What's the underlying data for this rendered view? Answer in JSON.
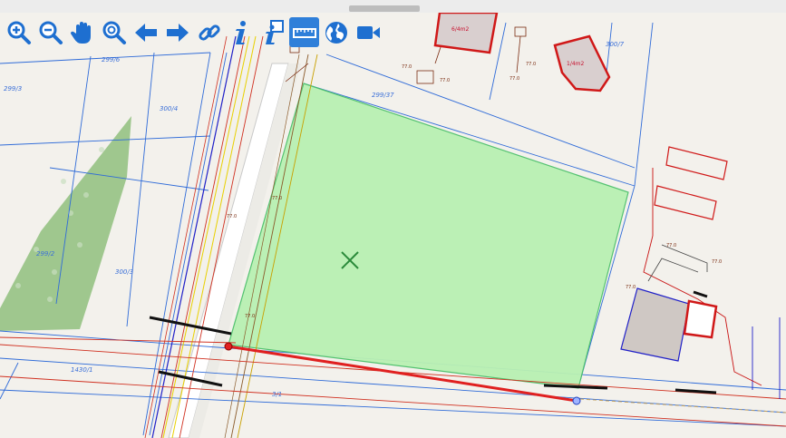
{
  "toolbar": {
    "tools": [
      {
        "name": "zoom-in",
        "icon": "zoom-in-icon"
      },
      {
        "name": "zoom-out",
        "icon": "zoom-out-icon"
      },
      {
        "name": "pan",
        "icon": "hand-icon"
      },
      {
        "name": "zoom-extent",
        "icon": "zoom-search-icon"
      },
      {
        "name": "back",
        "icon": "arrow-left-icon"
      },
      {
        "name": "forward",
        "icon": "arrow-right-icon"
      },
      {
        "name": "link",
        "icon": "chain-link-icon"
      },
      {
        "name": "info",
        "icon": "info-icon"
      },
      {
        "name": "info-extended",
        "icon": "info-document-icon"
      },
      {
        "name": "measure",
        "icon": "ruler-icon",
        "active": true
      },
      {
        "name": "globe",
        "icon": "globe-icon"
      },
      {
        "name": "video",
        "icon": "video-camera-icon"
      }
    ]
  },
  "map": {
    "parcel_labels": [
      "299/6",
      "299/3",
      "300/4",
      "300/3",
      "300/7",
      "299/37",
      "1430/1",
      "3/1",
      "299/2"
    ],
    "building_labels": [
      "6/4m2",
      "1/4m2"
    ],
    "selected_parcel_fill": "#b9f0b3",
    "measure_line_color": "#e02020"
  }
}
